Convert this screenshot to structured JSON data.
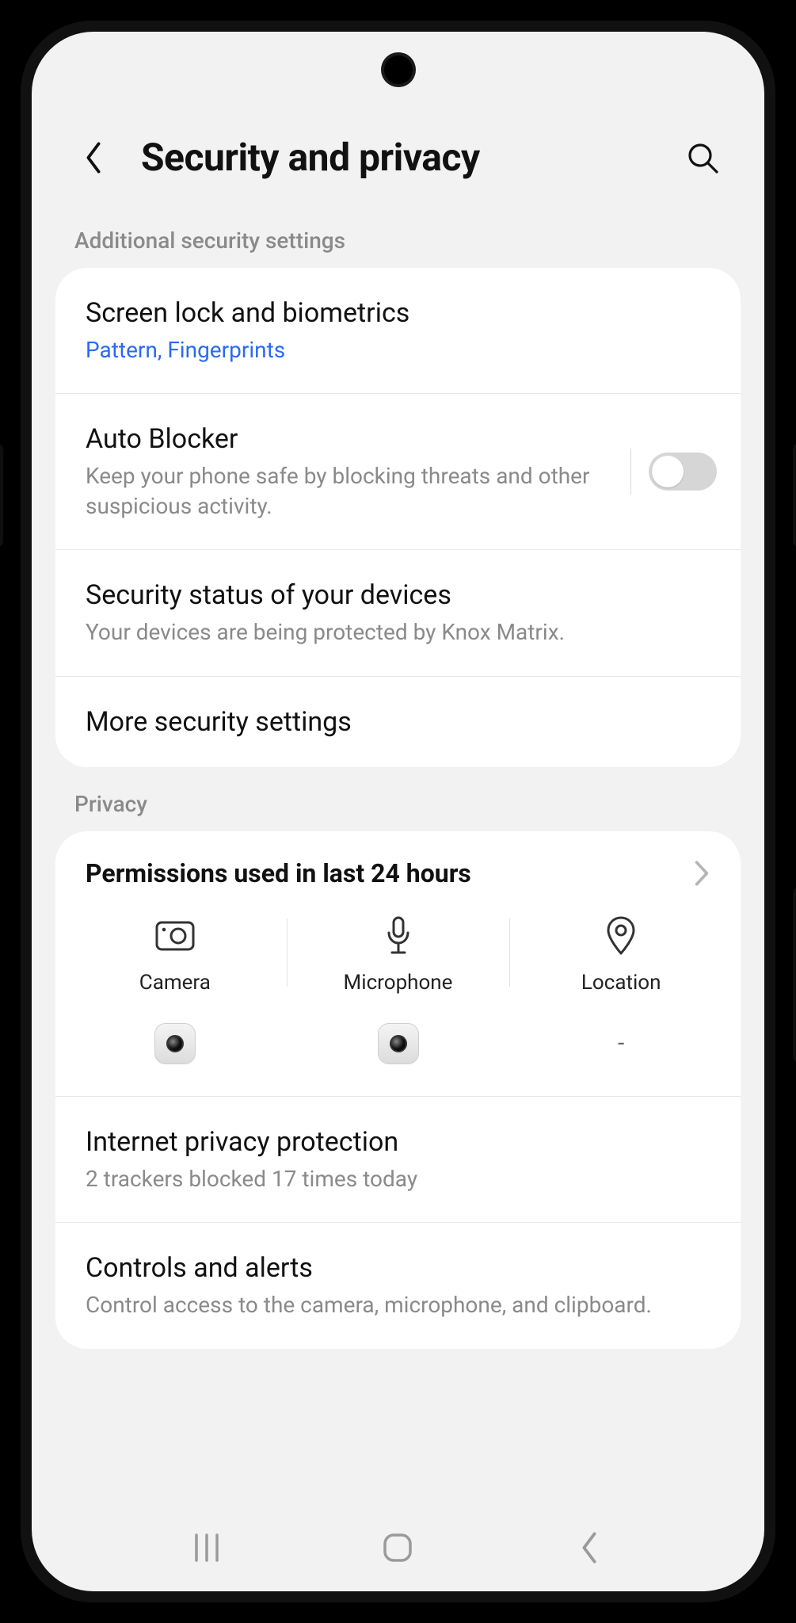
{
  "header": {
    "title": "Security and privacy"
  },
  "sections": {
    "security": {
      "label": "Additional security settings",
      "screen_lock": {
        "title": "Screen lock and biometrics",
        "sub": "Pattern, Fingerprints"
      },
      "auto_blocker": {
        "title": "Auto Blocker",
        "sub": "Keep your phone safe by blocking threats and other suspicious activity.",
        "enabled": false
      },
      "status": {
        "title": "Security status of your devices",
        "sub": "Your devices are being protected by Knox Matrix."
      },
      "more": {
        "title": "More security settings"
      }
    },
    "privacy": {
      "label": "Privacy",
      "permissions": {
        "title": "Permissions used in last 24 hours",
        "cols": [
          {
            "label": "Camera",
            "app": "camera-app"
          },
          {
            "label": "Microphone",
            "app": "camera-app"
          },
          {
            "label": "Location",
            "app": "-"
          }
        ]
      },
      "internet": {
        "title": "Internet privacy protection",
        "sub": "2 trackers blocked 17 times today"
      },
      "controls": {
        "title": "Controls and alerts",
        "sub": "Control access to the camera, microphone, and clipboard."
      }
    }
  }
}
